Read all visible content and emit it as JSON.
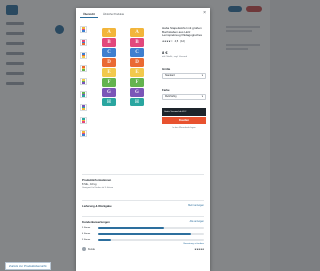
{
  "modal": {
    "tabs": [
      "Übersicht",
      "Ähnliche Produkte"
    ],
    "close_label": "×",
    "cube_letters": [
      "A",
      "B",
      "C",
      "D",
      "E",
      "F",
      "G",
      "H"
    ],
    "colors": {
      "cube_stack": [
        "#f2b53a",
        "#e2487c",
        "#3f7fcf",
        "#ea6a33",
        "#f2c94c",
        "#64b34f",
        "#7b56b8",
        "#2aa6a0"
      ],
      "accent": "#2d6f9e",
      "cta": "#e8522f"
    },
    "product": {
      "title": "Haba Stapelwürfel mit großen Buchstaben aus Holz Lernspielzeug Pädagogisches",
      "rating_value": "4,5",
      "rating_count": "(12)",
      "price": "8 €",
      "price_note": "inkl. MwSt., zzgl. Versand",
      "option1_label": "Größe",
      "option1_value": "Standard",
      "option2_label": "Farbe",
      "option2_value": "Mehrfarbig",
      "promo_text": "Gratis Versand ab 49 €",
      "add_to_cart": "Kaufen",
      "below_button": "In den Warenkorb legen"
    },
    "details": {
      "title": "Produktinformationen",
      "size": "8 Stk., 10 kg",
      "sub": "Geeignet für Kinder ab 3 Jahren"
    },
    "delivery": {
      "title": "Lieferung & Rückgabe",
      "link": "Mehr anzeigen"
    },
    "reviews": {
      "title": "Kundenbewertungen",
      "link": "Alle anzeigen",
      "bars": [
        {
          "label": "5 Sterne",
          "fraction": 0.62
        },
        {
          "label": "4 Sterne",
          "fraction": 0.88
        },
        {
          "label": "3 Sterne",
          "fraction": 0.12
        }
      ],
      "more_link": "Bewertung schreiben",
      "first_review": {
        "name": "Kunde",
        "stars": "★★★★★"
      }
    }
  },
  "background": {
    "bottom_link": "Zurück zur Produktübersicht"
  }
}
